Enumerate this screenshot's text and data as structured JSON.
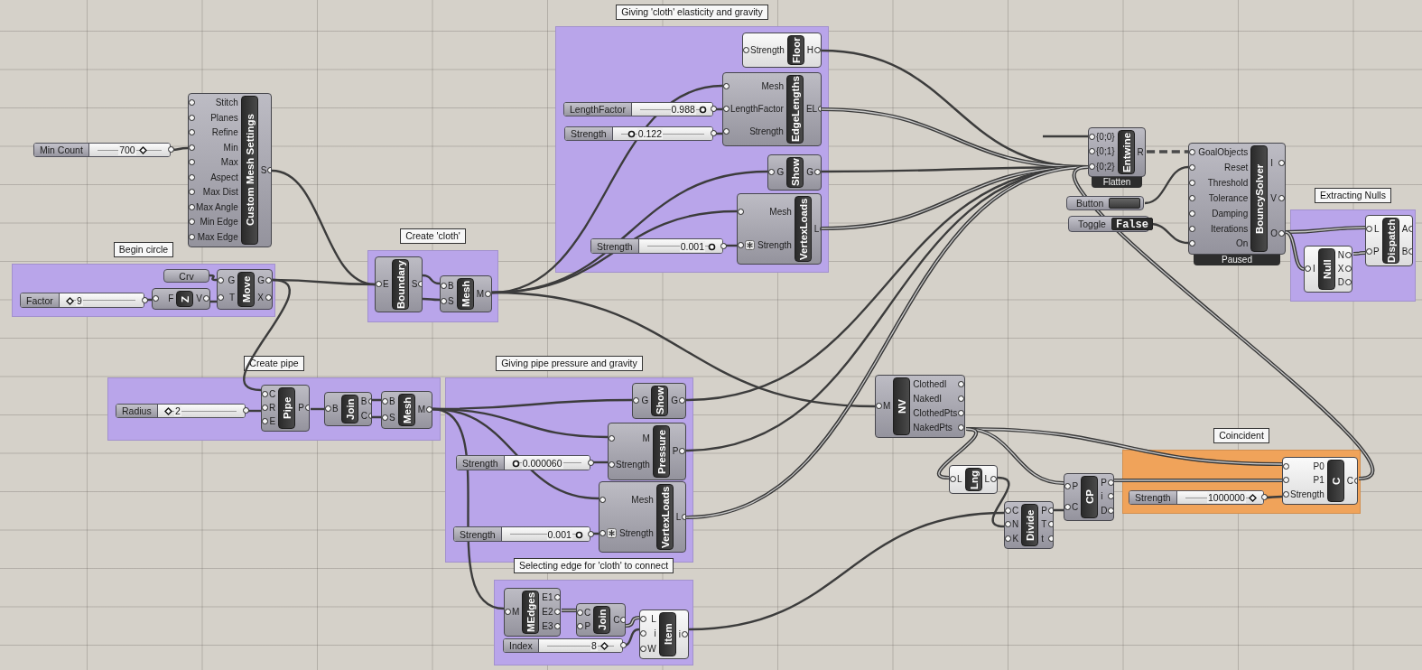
{
  "groups": [
    {
      "label": "Giving 'cloth' elasticity and gravity",
      "color": "#b9a5ea"
    },
    {
      "label": "Begin circle",
      "color": "#b9a5ea"
    },
    {
      "label": "Create 'cloth'",
      "color": "#b9a5ea"
    },
    {
      "label": "Create pipe",
      "color": "#b9a5ea"
    },
    {
      "label": "Giving pipe pressure and gravity",
      "color": "#b9a5ea"
    },
    {
      "label": "Selecting edge for 'cloth' to connect",
      "color": "#b9a5ea"
    },
    {
      "label": "Extracting Nulls",
      "color": "#b9a5ea"
    },
    {
      "label": "Coincident",
      "color": "#f0a35a"
    }
  ],
  "components": [
    {
      "name": "Custom Mesh Settings",
      "kind": "preview",
      "inputs": [
        "Stitch",
        "Planes",
        "Refine",
        "Min",
        "Max",
        "Aspect",
        "Max Dist",
        "Max Angle",
        "Min Edge",
        "Max Edge"
      ],
      "outputs": [
        "S"
      ]
    },
    {
      "name": "Move",
      "kind": "preview",
      "inputs": [
        "G",
        "T"
      ],
      "outputs": [
        "G",
        "X"
      ]
    },
    {
      "name": "Z",
      "kind": "preview",
      "inputs": [
        "F"
      ],
      "outputs": [
        "V"
      ]
    },
    {
      "name": "Boundary",
      "kind": "preview",
      "inputs": [
        "E"
      ],
      "outputs": [
        "S"
      ]
    },
    {
      "name": "Mesh",
      "kind": "preview",
      "inputs": [
        "B",
        "S"
      ],
      "outputs": [
        "M"
      ]
    },
    {
      "name": "Floor",
      "kind": "no-preview",
      "inputs": [
        "Strength"
      ],
      "outputs": [
        "H"
      ]
    },
    {
      "name": "EdgeLengths",
      "kind": "preview",
      "inputs": [
        "Mesh",
        "LengthFactor",
        "Strength"
      ],
      "outputs": [
        "EL"
      ]
    },
    {
      "name": "Show",
      "kind": "preview",
      "inputs": [
        "G"
      ],
      "outputs": [
        "G"
      ]
    },
    {
      "name": "VertexLoads",
      "kind": "preview",
      "inputs": [
        {
          "label": "Mesh",
          "expression": false
        },
        {
          "label": "Strength",
          "expression": true
        }
      ],
      "outputs": [
        "L"
      ]
    },
    {
      "name": "Entwine",
      "kind": "preview",
      "inputs": [
        "{0;0}",
        "{0;1}",
        "{0;2}"
      ],
      "outputs": [
        "R"
      ],
      "footer": "Flatten"
    },
    {
      "name": "BouncySolver",
      "kind": "preview",
      "inputs": [
        "GoalObjects",
        "Reset",
        "Threshold",
        "Tolerance",
        "Damping",
        "Iterations",
        "On"
      ],
      "outputs": [
        "I",
        "V",
        "O"
      ],
      "footer": "Paused"
    },
    {
      "name": "Null",
      "kind": "no-preview",
      "inputs": [
        "I"
      ],
      "outputs": [
        "N",
        "X",
        "D"
      ]
    },
    {
      "name": "Dispatch",
      "kind": "no-preview",
      "inputs": [
        "L",
        "P"
      ],
      "outputs": [
        "A",
        "B"
      ]
    },
    {
      "name": "NV",
      "kind": "preview",
      "inputs": [
        "M"
      ],
      "outputs": [
        "ClothedI",
        "NakedI",
        "ClothedPts",
        "NakedPts"
      ]
    },
    {
      "name": "Lng",
      "kind": "no-preview",
      "inputs": [
        "L"
      ],
      "outputs": [
        "L"
      ]
    },
    {
      "name": "CP",
      "kind": "preview",
      "inputs": [
        "P",
        "C"
      ],
      "outputs": [
        "P",
        "i",
        "D"
      ]
    },
    {
      "name": "Divide",
      "kind": "preview",
      "inputs": [
        "C",
        "N",
        "K"
      ],
      "outputs": [
        "P",
        "T",
        "t"
      ]
    },
    {
      "name": "C",
      "kind": "no-preview",
      "inputs": [
        "P0",
        "P1",
        "Strength"
      ],
      "outputs": [
        "C"
      ]
    },
    {
      "name": "Pipe",
      "kind": "preview",
      "inputs": [
        "C",
        "R",
        "E"
      ],
      "outputs": [
        "P"
      ]
    },
    {
      "name": "Join",
      "kind": "preview",
      "inputs": [
        "B"
      ],
      "outputs": [
        "B",
        "C"
      ]
    },
    {
      "name": "Mesh",
      "kind": "preview",
      "inputs": [
        "B",
        "S"
      ],
      "outputs": [
        "M"
      ]
    },
    {
      "name": "Show",
      "kind": "preview",
      "inputs": [
        "G"
      ],
      "outputs": [
        "G"
      ]
    },
    {
      "name": "Pressure",
      "kind": "preview",
      "inputs": [
        "M",
        "Strength"
      ],
      "outputs": [
        "P"
      ]
    },
    {
      "name": "VertexLoads",
      "kind": "preview",
      "inputs": [
        {
          "label": "Mesh",
          "expression": false
        },
        {
          "label": "Strength",
          "expression": true
        }
      ],
      "outputs": [
        "L"
      ]
    },
    {
      "name": "MEdges",
      "kind": "preview",
      "inputs": [
        "M"
      ],
      "outputs": [
        "E1",
        "E2",
        "E3"
      ]
    },
    {
      "name": "Join",
      "kind": "preview",
      "inputs": [
        "C",
        "P"
      ],
      "outputs": [
        "C"
      ]
    },
    {
      "name": "Item",
      "kind": "no-preview",
      "inputs": [
        "L",
        "i",
        "W"
      ],
      "outputs": [
        "i"
      ]
    }
  ],
  "sliders": [
    {
      "label": "Min Count",
      "value": "700",
      "kind": "integer",
      "level": 0.7
    },
    {
      "label": "Factor",
      "value": "9",
      "kind": "integer",
      "level": 0.03
    },
    {
      "label": "LengthFactor",
      "value": "0.988",
      "kind": "float",
      "level": 0.97
    },
    {
      "label": "Strength",
      "value": "0.122",
      "kind": "float",
      "level": 0.12
    },
    {
      "label": "Strength",
      "value": "0.001",
      "kind": "float",
      "level": 0.96
    },
    {
      "label": "Strength",
      "value": "1000000",
      "kind": "integer",
      "level": 0.96
    },
    {
      "label": "Radius",
      "value": "2",
      "kind": "integer",
      "level": 0.03
    },
    {
      "label": "Strength",
      "value": "0.000060",
      "kind": "float",
      "level": 0.04
    },
    {
      "label": "Strength",
      "value": "0.001",
      "kind": "float",
      "level": 0.96
    },
    {
      "label": "Index",
      "value": "8",
      "kind": "integer",
      "level": 0.85
    }
  ],
  "params": [
    {
      "label": "Crv"
    }
  ],
  "button": {
    "label": "Button"
  },
  "toggle": {
    "label": "Toggle",
    "value": "False"
  }
}
